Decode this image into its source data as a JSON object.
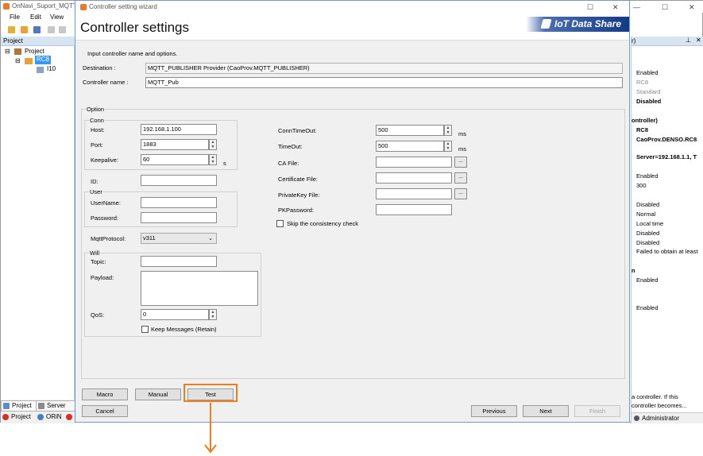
{
  "bg_app": {
    "title": "OnNavi_Suport_MQTT",
    "menu": [
      "File",
      "Edit",
      "View"
    ],
    "project_panel_title": "Project",
    "tree": {
      "root": "Project",
      "controller": "RC8",
      "child": "I10"
    },
    "bottom_tabs": [
      "Project",
      "Server"
    ],
    "status_items": [
      "Project",
      "ORiN"
    ],
    "right_panel": {
      "header": "r)",
      "rows": [
        {
          "text": "Enabled",
          "bold": false
        },
        {
          "text": "RC8",
          "bold": false
        },
        {
          "text": "Standard",
          "bold": false
        },
        {
          "text": "Disabled",
          "bold": true
        },
        {
          "text": "ontroller)",
          "bold": true
        },
        {
          "text": "RC8",
          "bold": true
        },
        {
          "text": "CaoProv.DENSO.RC8",
          "bold": true
        },
        {
          "text": "Server=192.168.1.1, T",
          "bold": true
        },
        {
          "text": "Enabled",
          "bold": false
        },
        {
          "text": "300",
          "bold": false
        },
        {
          "text": "Disabled",
          "bold": false
        },
        {
          "text": "Normal",
          "bold": false
        },
        {
          "text": "Local time",
          "bold": false
        },
        {
          "text": "Disabled",
          "bold": false
        },
        {
          "text": "Disabled",
          "bold": false
        },
        {
          "text": "Failed to obtain at least",
          "bold": false
        },
        {
          "text": "n",
          "bold": true
        },
        {
          "text": "Enabled",
          "bold": false
        },
        {
          "text": "Enabled",
          "bold": false
        }
      ],
      "footer_text_1": "a controller. If this",
      "footer_text_2": "controller becomes...",
      "status_user": "Administrator"
    }
  },
  "dialog": {
    "window_title": "Controller setting wizard",
    "heading": "Controller settings",
    "brand": "IoT Data Share",
    "instruction": "Input controller name and options.",
    "destination_label": "Destination :",
    "destination_value": "MQTT_PUBLISHER Provider (CaoProv.MQTT_PUBLISHER)",
    "controller_name_label": "Controller name :",
    "controller_name_value": "MQTT_Pub",
    "option_group": "Option",
    "conn_group": "Conn",
    "host_label": "Host:",
    "host_value": "192.168.1.100",
    "port_label": "Port:",
    "port_value": "1883",
    "keepalive_label": "Keepalive:",
    "keepalive_value": "60",
    "keepalive_unit": "s",
    "id_label": "ID:",
    "id_value": "",
    "user_group": "User",
    "username_label": "UserName:",
    "password_label": "Password:",
    "mqttprotocol_label": "MqttProtocol:",
    "mqttprotocol_value": "v311",
    "will_group": "Will",
    "topic_label": "Topic:",
    "payload_label": "Payload:",
    "qos_label": "QoS:",
    "qos_value": "0",
    "keep_messages_label": "Keep Messages (Retain)",
    "conntimeout_label": "ConnTimeOut:",
    "conntimeout_value": "500",
    "conntimeout_unit": "ms",
    "timeout_label": "TimeOut:",
    "timeout_value": "500",
    "timeout_unit": "ms",
    "ca_file_label": "CA File:",
    "certificate_file_label": "Certificate File:",
    "privatekey_file_label": "PrivateKey File:",
    "pkpassword_label": "PKPassword:",
    "browse_label": "...",
    "skip_check_label": "Skip the consistency check",
    "buttons": {
      "macro": "Macro",
      "manual": "Manual",
      "test": "Test",
      "cancel": "Cancel",
      "previous": "Previous",
      "next": "Next",
      "finish": "Finish"
    }
  },
  "colors": {
    "highlight": "#f07d1a",
    "brand_dark": "#123a86",
    "selection": "#3399ff"
  }
}
